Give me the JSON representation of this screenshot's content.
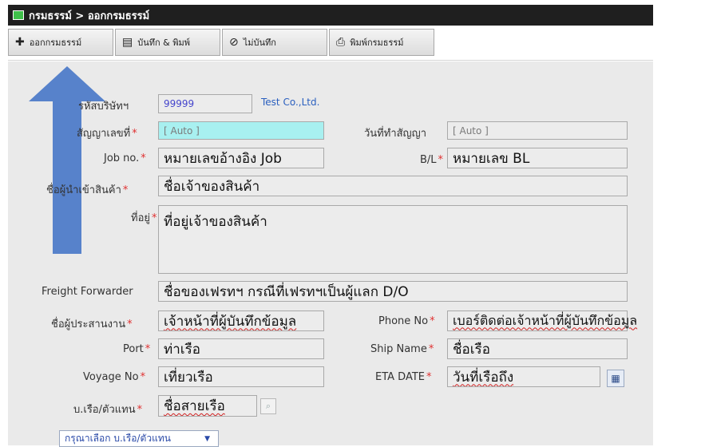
{
  "window": {
    "title": "กรมธรรม์ > ออกกรมธรรม์"
  },
  "toolbar": {
    "issue": {
      "icon": "plus-icon",
      "label": "ออกกรมธรรม์"
    },
    "save_print": {
      "icon": "save-icon",
      "label": "บันทึก & พิมพ์"
    },
    "no_save": {
      "icon": "cancel-icon",
      "label": "ไม่บันทึก"
    },
    "print_policy": {
      "icon": "printer-icon",
      "label": "พิมพ์กรมธรรม์"
    }
  },
  "form": {
    "company_code": {
      "label": "รหัสบริษัทฯ",
      "value": "99999",
      "company_name": "Test Co.,Ltd."
    },
    "contract_no": {
      "label": "สัญญาเลขที่",
      "required": "*",
      "value": "[ Auto ]"
    },
    "contract_date": {
      "label": "วันที่ทำสัญญา",
      "value": "[ Auto ]"
    },
    "job_no": {
      "label": "Job no.",
      "required": "*",
      "value": "หมายเลขอ้างอิง Job"
    },
    "bl": {
      "label": "B/L",
      "required": "*",
      "value": "หมายเลข BL"
    },
    "importer": {
      "label": "ชื่อผู้นำเข้าสินค้า",
      "required": "*",
      "value": "ชื่อเจ้าของสินค้า"
    },
    "address": {
      "label": "ที่อยู่",
      "required": "*",
      "value": "ที่อยู่เจ้าของสินค้า"
    },
    "freight_forwarder": {
      "label": "Freight Forwarder",
      "value": "ชื่อของเฟรทฯ กรณีที่เฟรทฯเป็นผู้แลก D/O"
    },
    "coordinator": {
      "label": "ชื่อผู้ประสานงาน",
      "required": "*",
      "value": "เจ้าหน้าที่ผู้บันทึกข้อมูล"
    },
    "phone": {
      "label": "Phone No",
      "required": "*",
      "value": "เบอร์ติดต่อเจ้าหน้าที่ผู้บันทึกข้อมูล"
    },
    "port": {
      "label": "Port",
      "required": "*",
      "value": "ท่าเรือ"
    },
    "ship_name": {
      "label": "Ship Name",
      "required": "*",
      "value": "ชื่อเรือ"
    },
    "voyage": {
      "label": "Voyage No",
      "required": "*",
      "value": "เที่ยวเรือ"
    },
    "eta": {
      "label": "ETA DATE",
      "required": "*",
      "value": "วันที่เรือถึง",
      "icon": "calendar-icon"
    },
    "shipping_agent": {
      "label": "บ.เรือ/ตัวแทน",
      "required": "*",
      "value": "ชื่อสายเรือ",
      "icon": "search-icon"
    },
    "agent_select": {
      "value": "กรุณาเลือก บ.เรือ/ตัวแทน"
    }
  },
  "colors": {
    "title_bg": "#1f1f1f",
    "form_bg": "#eaeaea",
    "highlight_field": "#a8f0f0",
    "arrow": "#4a78c8",
    "required": "#e03030"
  }
}
